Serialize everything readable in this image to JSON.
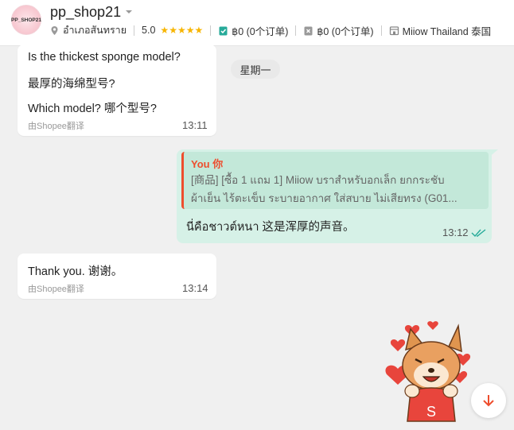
{
  "header": {
    "avatar_text": "PP_SHOP21",
    "shop_name": "pp_shop21",
    "location": "อำเภอสันทราย",
    "rating": "5.0",
    "stars": 5,
    "paid_orders": "฿0 (0个订单)",
    "pending_orders": "฿0 (0个订单)",
    "store": "Miiow Thailand  泰国"
  },
  "day_label": "星期一",
  "messages": {
    "m1": {
      "line1": "Is the thickest sponge model?",
      "line2": "最厚的海绵型号?",
      "line3": "Which model?  哪个型号?",
      "translated_by": "由Shopee翻译",
      "time": "13:11"
    },
    "m2": {
      "quote_author": "You  你",
      "quote_line1": "[商品] [ซื้อ 1 แถม 1] Miiow บราสำหรับอกเล็ก ยกกระชับ",
      "quote_line2": "ผ้าเย็น ไร้ตะเข็บ ระบายอากาศ ใส่สบาย ไม่เสียทรง (G01...",
      "text": "นี่คือชาวต์หนา  这是浑厚的声音。",
      "time": "13:12"
    },
    "m3": {
      "text": "Thank you.  谢谢。",
      "translated_by": "由Shopee翻译",
      "time": "13:14"
    }
  },
  "mascot": {
    "badge": "S"
  },
  "colors": {
    "accent": "#ee4d2d",
    "outgoing_bg": "#d6f1e7",
    "star": "#f7b500",
    "read_ticks": "#26aa99"
  }
}
